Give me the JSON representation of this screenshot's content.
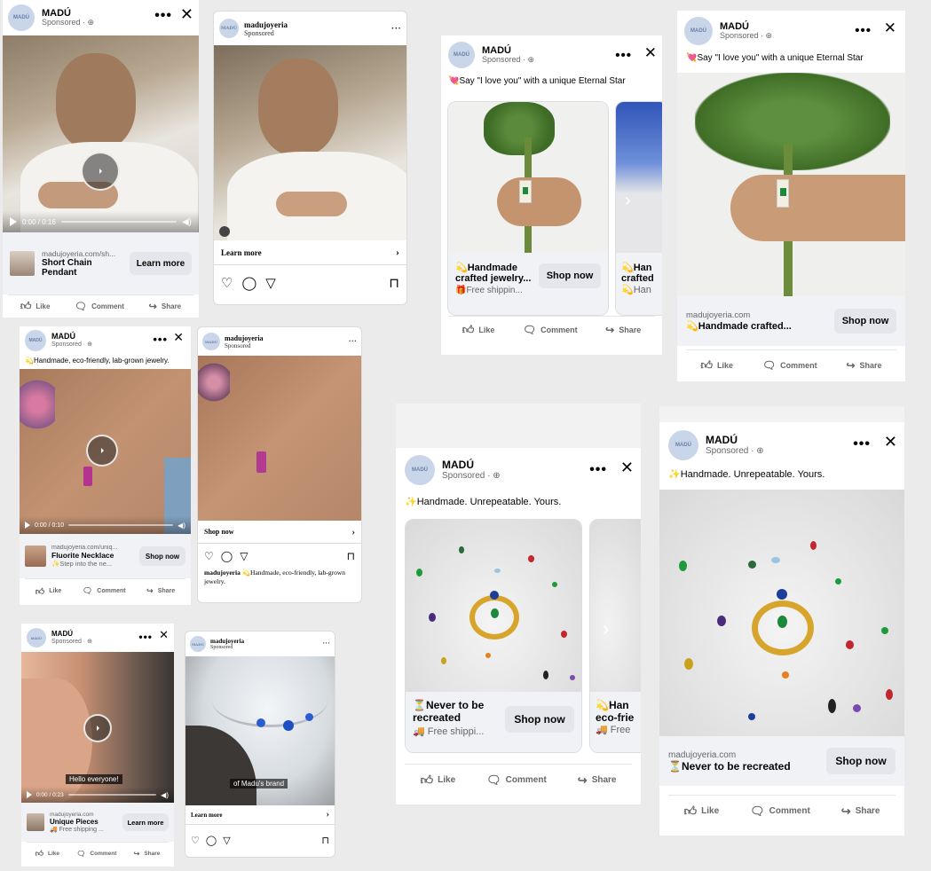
{
  "brand": {
    "name": "MADÚ",
    "sponsored": "Sponsored · ⊕",
    "ig_handle": "madujoyeria",
    "ig_sponsored": "Sponsored",
    "avatar_text": "MADÚ"
  },
  "actions": {
    "like": "Like",
    "comment": "Comment",
    "share": "Share"
  },
  "ad1": {
    "time": "0:00 / 0:16",
    "domain": "madujoyeria.com/sh...",
    "title_line1": "Short Chain",
    "title_line2": "Pendant",
    "cta": "Learn more"
  },
  "ad2": {
    "cta_row": "Learn more"
  },
  "ad3": {
    "caption": "💘Say \"I love you\" with a unique Eternal Star",
    "card_title_line1": "💫Handmade",
    "card_title_line2": "crafted jewelry...",
    "card_sub": "🎁Free shippin...",
    "cta": "Shop now",
    "peek_line1": "💫Han",
    "peek_line2": "crafted",
    "peek_line3": "💫Han"
  },
  "ad4": {
    "caption": "💘Say \"I love you\" with a unique Eternal Star",
    "domain": "madujoyeria.com",
    "title": "💫Handmade crafted...",
    "cta": "Shop now"
  },
  "ad5": {
    "caption": "💫Handmade, eco-friendly, lab-grown jewelry.",
    "time": "0:00 / 0:10",
    "domain": "madujoyeria.com/uniq...",
    "title": "Fluorite Necklace",
    "sub": "✨Step into the ne...",
    "cta": "Shop now"
  },
  "ad6": {
    "cta_row": "Shop now",
    "caption_handle": "madujoyeria",
    "caption_text": "💫Handmade, eco-friendly, lab-grown jewelry."
  },
  "ad7": {
    "caption": "✨Handmade. Unrepeatable. Yours.",
    "card_title_line1": "⏳Never to be",
    "card_title_line2": "recreated",
    "card_sub": "🚚 Free shippi...",
    "cta": "Shop now",
    "peek_line1": "💫Han",
    "peek_line2": "eco-frie",
    "peek_line3": "🚚 Free"
  },
  "ad8": {
    "caption": "✨Handmade. Unrepeatable. Yours.",
    "domain": "madujoyeria.com",
    "title": "⏳Never to be recreated",
    "cta": "Shop now"
  },
  "ad9": {
    "subtitle": "Hello everyone!",
    "time": "0:00 / 0:23",
    "domain": "madujoyeria.com",
    "title": "Unique Pieces",
    "sub": "🚚 Free shipping ...",
    "cta": "Learn more"
  },
  "ad10": {
    "subtitle": "of Madu's brand",
    "cta_row": "Learn more"
  },
  "colors": {
    "page_bg": "#ebebeb",
    "button_bg": "#e4e6eb",
    "muted": "#65676b",
    "avatar_bg": "#c9d6ea"
  }
}
